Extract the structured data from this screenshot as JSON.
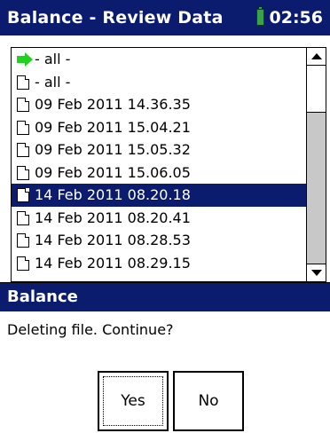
{
  "window": {
    "title": "Balance - Review Data",
    "time": "02:56",
    "status_icon": "battery-icon",
    "colors": {
      "titlebar": "#0b1c6e",
      "selection": "#0b1c6e",
      "accent_green": "#1fd21f"
    }
  },
  "list": {
    "items": [
      {
        "label": "- all -",
        "icon": "green-arrow-icon",
        "selected": false
      },
      {
        "label": "- all -",
        "icon": "file-icon",
        "selected": false
      },
      {
        "label": "09 Feb 2011 14.36.35",
        "icon": "file-icon",
        "selected": false
      },
      {
        "label": "09 Feb 2011 15.04.21",
        "icon": "file-icon",
        "selected": false
      },
      {
        "label": "09 Feb 2011 15.05.32",
        "icon": "file-icon",
        "selected": false
      },
      {
        "label": "09 Feb 2011 15.06.05",
        "icon": "file-icon",
        "selected": false
      },
      {
        "label": "14 Feb 2011 08.20.18",
        "icon": "file-icon",
        "selected": true
      },
      {
        "label": "14 Feb 2011 08.20.41",
        "icon": "file-icon",
        "selected": false
      },
      {
        "label": "14 Feb 2011 08.28.53",
        "icon": "file-icon",
        "selected": false
      },
      {
        "label": "14 Feb 2011 08.29.15",
        "icon": "file-icon",
        "selected": false
      }
    ]
  },
  "dialog": {
    "title": "Balance",
    "message": "Deleting file. Continue?",
    "yes_label": "Yes",
    "no_label": "No",
    "focused_button": "Yes"
  }
}
